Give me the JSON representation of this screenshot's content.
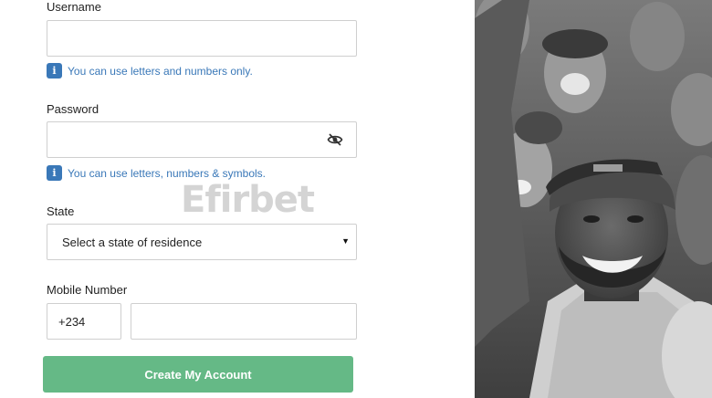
{
  "form": {
    "username_label": "Username",
    "username_value": "",
    "username_hint": "You can use letters and numbers only.",
    "password_label": "Password",
    "password_value": "",
    "password_hint": "You can use letters, numbers & symbols.",
    "state_label": "State",
    "state_selected": "Select a state of residence",
    "mobile_label": "Mobile Number",
    "mobile_prefix": "+234",
    "mobile_value": "",
    "submit_label": "Create My Account"
  },
  "watermark": "Efirbet",
  "icons": {
    "info": "info-icon",
    "password_toggle": "eye-slash-icon",
    "dropdown": "chevron-down-icon"
  },
  "colors": {
    "accent_blue": "#3a78b8",
    "cta_green": "#65b986",
    "border": "#cfcfcf"
  }
}
